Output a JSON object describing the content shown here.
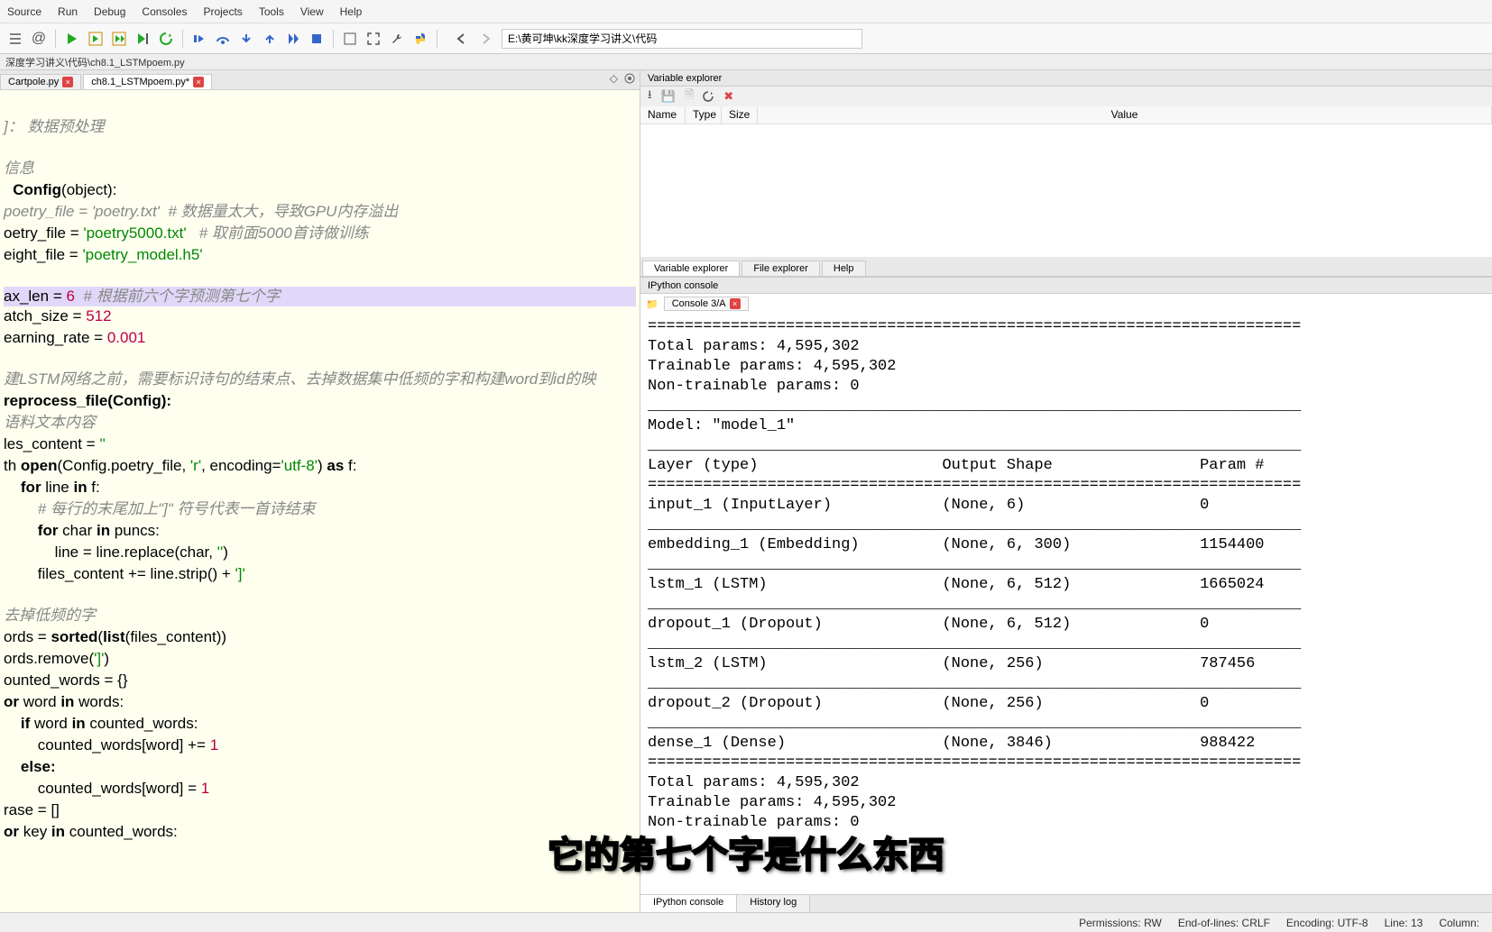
{
  "menu": [
    "Source",
    "Run",
    "Debug",
    "Consoles",
    "Projects",
    "Tools",
    "View",
    "Help"
  ],
  "path_input": "E:\\黄可坤\\kk深度学习讲义\\代码",
  "breadcrumb": "深度学习讲义\\代码\\ch8.1_LSTMpoem.py",
  "tabs": {
    "t1": "Cartpole.py",
    "t2": "ch8.1_LSTMpoem.py*"
  },
  "ve_title": "Variable explorer",
  "ve_cols": {
    "name": "Name",
    "type": "Type",
    "size": "Size",
    "value": "Value"
  },
  "ve_tabs": {
    "a": "Variable explorer",
    "b": "File explorer",
    "c": "Help"
  },
  "ipc_title": "IPython console",
  "ipc_tab": "Console 3/A",
  "bottom_tabs": {
    "a": "IPython console",
    "b": "History log"
  },
  "status": {
    "perm": "Permissions: RW",
    "eol": "End-of-lines: CRLF",
    "enc": "Encoding: UTF-8",
    "line": "Line: 13",
    "col": "Column:"
  },
  "subtitle": "它的第七个字是什么东西",
  "code": {
    "l1": "]： 数据预处理",
    "l2": "信息",
    "l3a": "Config",
    "l3b": "(object):",
    "l4a": "poetry_file = ",
    "l4b": "'poetry.txt'",
    "l4c": "  # 数据量太大，导致GPU内存溢出",
    "l5a": "oetry_file = ",
    "l5b": "'poetry5000.txt'",
    "l5c": "   # 取前面5000首诗做训练",
    "l6a": "eight_file = ",
    "l6b": "'poetry_model.h5'",
    "l7a": "ax_len = ",
    "l7b": "6",
    "l7c": "  # 根据前六个字预测第七个字",
    "l8a": "atch_size = ",
    "l8b": "512",
    "l9a": "earning_rate = ",
    "l9b": "0.001",
    "l10": "建LSTM网络之前，需要标识诗句的结束点、去掉数据集中低频的字和构建word到id的映",
    "l11": "reprocess_file(Config):",
    "l12": "语料文本内容",
    "l13a": "les_content = ",
    "l13b": "''",
    "l14a": "th ",
    "l14b": "open",
    "l14c": "(Config.poetry_file, ",
    "l14d": "'r'",
    "l14e": ", encoding=",
    "l14f": "'utf-8'",
    "l14g": ") ",
    "l14h": "as",
    "l14i": " f:",
    "l15a": "    for ",
    "l15b": "line ",
    "l15c": "in",
    "l15d": " f:",
    "l16": "        # 每行的末尾加上\"]\" 符号代表一首诗结束",
    "l17a": "        for ",
    "l17b": "char ",
    "l17c": "in",
    "l17d": " puncs:",
    "l18a": "            line = line.replace(char, ",
    "l18b": "''",
    "l18c": ")",
    "l19a": "        files_content += line.strip() + ",
    "l19b": "']'",
    "l20": "去掉低频的字",
    "l21a": "ords = ",
    "l21b": "sorted",
    "l21c": "(",
    "l21d": "list",
    "l21e": "(files_content))",
    "l22a": "ords.remove(",
    "l22b": "']'",
    "l22c": ")",
    "l23": "ounted_words = {}",
    "l24a": "or ",
    "l24b": "word ",
    "l24c": "in",
    "l24d": " words:",
    "l25a": "    if ",
    "l25b": "word ",
    "l25c": "in",
    "l25d": " counted_words:",
    "l26a": "        counted_words[word] += ",
    "l26b": "1",
    "l27": "    else:",
    "l28a": "        counted_words[word] = ",
    "l28b": "1",
    "l29": "rase = []",
    "l30a": "or ",
    "l30b": "key ",
    "l30c": "in",
    "l30d": " counted_words:"
  },
  "chart_data": {
    "type": "table",
    "headers": [
      "Layer (type)",
      "Output Shape",
      "Param #"
    ],
    "rows": [
      [
        "input_1 (InputLayer)",
        "(None, 6)",
        "0"
      ],
      [
        "embedding_1 (Embedding)",
        "(None, 6, 300)",
        "1154400"
      ],
      [
        "lstm_1 (LSTM)",
        "(None, 6, 512)",
        "1665024"
      ],
      [
        "dropout_1 (Dropout)",
        "(None, 6, 512)",
        "0"
      ],
      [
        "lstm_2 (LSTM)",
        "(None, 256)",
        "787456"
      ],
      [
        "dropout_2 (Dropout)",
        "(None, 256)",
        "0"
      ],
      [
        "dense_1 (Dense)",
        "(None, 3846)",
        "988422"
      ]
    ],
    "summary_top": [
      "Total params: 4,595,302",
      "Trainable params: 4,595,302",
      "Non-trainable params: 0"
    ],
    "model_line": "Model: \"model_1\"",
    "summary_bottom": [
      "Total params: 4,595,302",
      "Trainable params: 4,595,302"
    ],
    "nontrain": "ms: 0"
  }
}
